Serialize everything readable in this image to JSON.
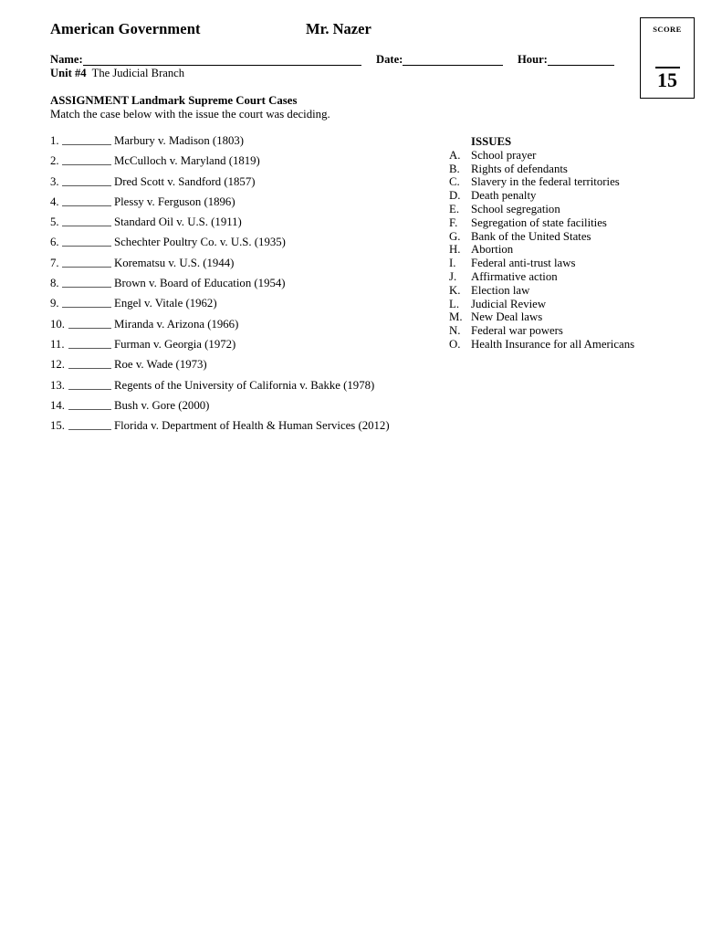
{
  "header": {
    "course_title": "American Government",
    "teacher_name": "Mr. Nazer"
  },
  "score_box": {
    "label": "SCORE",
    "total_points": "15"
  },
  "fields": {
    "name_label": "Name:",
    "date_label": "Date:",
    "hour_label": "Hour:",
    "name_value": "",
    "date_value": "",
    "hour_value": ""
  },
  "unit": {
    "label": "Unit #4",
    "value": "The Judicial Branch"
  },
  "assignment": {
    "heading": "ASSIGNMENT Landmark Supreme Court Cases",
    "instructions": "Match the case below with the issue the court was deciding."
  },
  "cases": [
    {
      "number": "1.",
      "name": "Marbury v. Madison (1803)",
      "answer": ""
    },
    {
      "number": "2.",
      "name": "McCulloch v. Maryland (1819)",
      "answer": ""
    },
    {
      "number": "3.",
      "name": "Dred Scott v. Sandford (1857)",
      "answer": ""
    },
    {
      "number": "4.",
      "name": "Plessy v. Ferguson (1896)",
      "answer": ""
    },
    {
      "number": "5.",
      "name": "Standard Oil v. U.S. (1911)",
      "answer": ""
    },
    {
      "number": "6.",
      "name": "Schechter Poultry Co. v. U.S. (1935)",
      "answer": ""
    },
    {
      "number": "7.",
      "name": "Korematsu v. U.S. (1944)",
      "answer": ""
    },
    {
      "number": "8.",
      "name": "Brown v. Board of Education (1954)",
      "answer": ""
    },
    {
      "number": "9.",
      "name": "Engel v. Vitale (1962)",
      "answer": ""
    },
    {
      "number": "10.",
      "name": "Miranda v. Arizona (1966)",
      "answer": ""
    },
    {
      "number": "11.",
      "name": "Furman v. Georgia (1972)",
      "answer": ""
    },
    {
      "number": "12.",
      "name": "Roe v. Wade (1973)",
      "answer": ""
    },
    {
      "number": "13.",
      "name": "Regents of the University of California v. Bakke (1978)",
      "answer": ""
    },
    {
      "number": "14.",
      "name": "Bush v. Gore (2000)",
      "answer": ""
    },
    {
      "number": "15.",
      "name": "Florida v. Department of Health & Human Services (2012)",
      "answer": ""
    }
  ],
  "issues": {
    "heading": "ISSUES",
    "items": [
      {
        "letter": "A.",
        "text": "School prayer"
      },
      {
        "letter": "B.",
        "text": "Rights of defendants"
      },
      {
        "letter": "C.",
        "text": "Slavery in the federal territories"
      },
      {
        "letter": "D.",
        "text": "Death penalty"
      },
      {
        "letter": "E.",
        "text": "School segregation"
      },
      {
        "letter": "F.",
        "text": "Segregation of state facilities"
      },
      {
        "letter": "G.",
        "text": "Bank of the United States"
      },
      {
        "letter": "H.",
        "text": "Abortion"
      },
      {
        "letter": "I.",
        "text": "Federal anti-trust laws"
      },
      {
        "letter": "J.",
        "text": "Affirmative action"
      },
      {
        "letter": "K.",
        "text": "Election law"
      },
      {
        "letter": "L.",
        "text": "Judicial Review"
      },
      {
        "letter": "M.",
        "text": "New Deal laws"
      },
      {
        "letter": "N.",
        "text": "Federal war powers"
      },
      {
        "letter": "O.",
        "text": "Health Insurance for all Americans"
      }
    ]
  }
}
